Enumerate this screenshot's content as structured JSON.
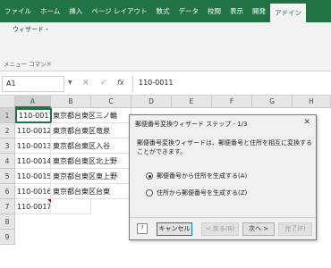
{
  "ribbon": {
    "tabs": [
      "ファイル",
      "ホーム",
      "挿入",
      "ページ レイアウト",
      "数式",
      "データ",
      "校閲",
      "表示",
      "開発",
      "アドイン"
    ],
    "active_tab_index": 9,
    "wizard_menu": "ウィザード・",
    "menu_command_label": "メニュー コマンド",
    "accent": "#217346"
  },
  "formula_bar": {
    "name_box": "A1",
    "content": "110-0011"
  },
  "grid": {
    "columns": [
      "A",
      "B",
      "C",
      "D",
      "E",
      "F",
      "G",
      "H"
    ],
    "rows": [
      "1",
      "2",
      "3",
      "4",
      "5",
      "6",
      "7",
      "8",
      "9"
    ],
    "col_a": [
      "110-0011",
      "110-0012",
      "110-0013",
      "110-0014",
      "110-0015",
      "110-0016",
      "110-0017"
    ],
    "col_b": [
      "東京都台東区三ノ輪",
      "東京都台東区竜泉",
      "東京都台東区入谷",
      "東京都台東区北上野",
      "東京都台東区東上野",
      "東京都台東区台東",
      ""
    ]
  },
  "dialog": {
    "title": "郵便番号変換ウィザード ステップ - 1/3",
    "description": "郵便番号変換ウィザードは、郵便番号と住所を相互に変換することができます。",
    "option_1": "郵便番号から住所を生成する(A)",
    "option_2": "住所から郵便番号を生成する(Z)",
    "selected_option": 1,
    "buttons": {
      "cancel": "キャンセル",
      "back": "< 戻る(B)",
      "next": "次へ >",
      "finish": "完了(F)"
    }
  }
}
